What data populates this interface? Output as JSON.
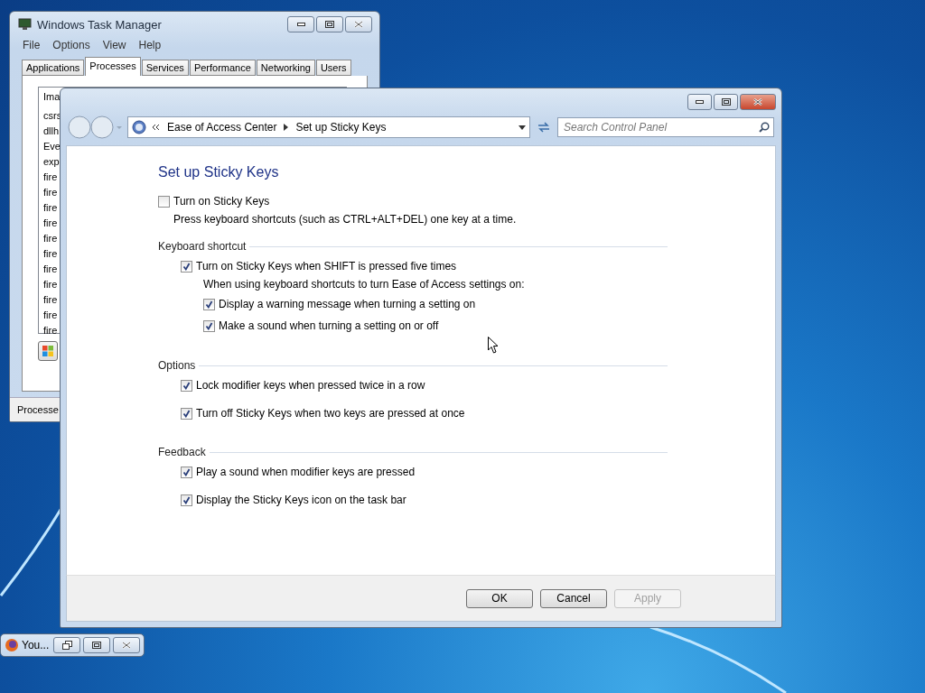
{
  "task_manager": {
    "title": "Windows Task Manager",
    "menu": [
      "File",
      "Options",
      "View",
      "Help"
    ],
    "tabs": [
      {
        "label": "Applications",
        "selected": false
      },
      {
        "label": "Processes",
        "selected": true
      },
      {
        "label": "Services",
        "selected": false
      },
      {
        "label": "Performance",
        "selected": false
      },
      {
        "label": "Networking",
        "selected": false
      },
      {
        "label": "Users",
        "selected": false
      }
    ],
    "list": {
      "column": "Ima",
      "rows": [
        "csrs",
        "dllh",
        "Eve",
        "exp",
        "fire",
        "fire",
        "fire",
        "fire",
        "fire",
        "fire",
        "fire",
        "fire",
        "fire",
        "fire",
        "fire"
      ]
    },
    "status": "Processe"
  },
  "dialog": {
    "breadcrumb": [
      "Ease of Access Center",
      "Set up Sticky Keys"
    ],
    "search": {
      "placeholder": "Search Control Panel"
    },
    "heading": "Set up Sticky Keys",
    "main_option": {
      "label": "Turn on Sticky Keys",
      "checked": false
    },
    "description": "Press keyboard shortcuts (such as CTRL+ALT+DEL) one key at a time.",
    "sections": [
      {
        "title": "Keyboard shortcut",
        "items": [
          {
            "kind": "checkbox",
            "label": "Turn on Sticky Keys when SHIFT is pressed five times",
            "checked": true,
            "children": [
              {
                "kind": "note",
                "label": "When using keyboard shortcuts to turn Ease of Access settings on:"
              },
              {
                "kind": "checkbox",
                "label": "Display a warning message when turning a setting on",
                "checked": true
              },
              {
                "kind": "checkbox",
                "label": "Make a sound when turning a setting on or off",
                "checked": true
              }
            ]
          }
        ]
      },
      {
        "title": "Options",
        "items": [
          {
            "kind": "checkbox",
            "label": "Lock modifier keys when pressed twice in a row",
            "checked": true
          },
          {
            "kind": "checkbox",
            "label": "Turn off Sticky Keys when two keys are pressed at once",
            "checked": true
          }
        ]
      },
      {
        "title": "Feedback",
        "items": [
          {
            "kind": "checkbox",
            "label": "Play a sound when modifier keys are pressed",
            "checked": true
          },
          {
            "kind": "checkbox",
            "label": "Display the Sticky Keys icon on the task bar",
            "checked": true
          }
        ]
      }
    ],
    "buttons": [
      {
        "label": "OK",
        "disabled": false
      },
      {
        "label": "Cancel",
        "disabled": false
      },
      {
        "label": "Apply",
        "disabled": true
      }
    ]
  },
  "minimized_window": {
    "title": "You..."
  }
}
